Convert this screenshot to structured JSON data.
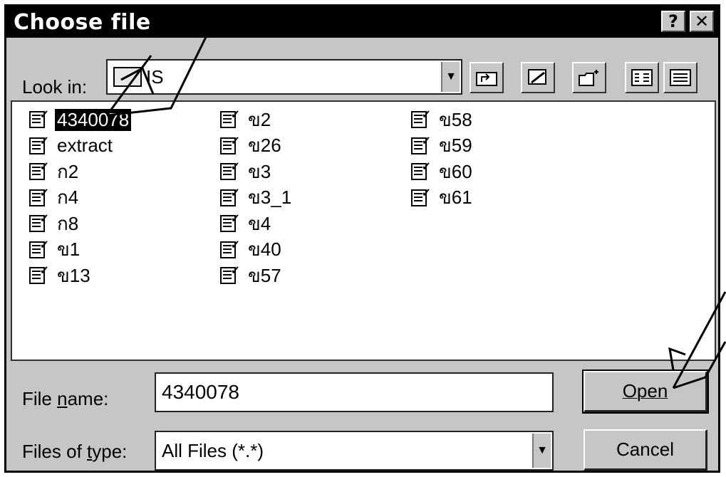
{
  "dialog": {
    "title": "Choose file",
    "help_label": "?",
    "close_label": "✕"
  },
  "lookin": {
    "label": "Look in:",
    "value": "IS"
  },
  "files": [
    {
      "name": "4340078",
      "selected": true
    },
    {
      "name": "extract"
    },
    {
      "name": "ก2"
    },
    {
      "name": "ก4"
    },
    {
      "name": "ก8"
    },
    {
      "name": "ข1"
    },
    {
      "name": "ข13"
    },
    {
      "name": "ข2"
    },
    {
      "name": "ข26"
    },
    {
      "name": "ข3"
    },
    {
      "name": "ข3_1"
    },
    {
      "name": "ข4"
    },
    {
      "name": "ข40"
    },
    {
      "name": "ข57"
    },
    {
      "name": "ข58"
    },
    {
      "name": "ข59"
    },
    {
      "name": "ข60"
    },
    {
      "name": "ข61"
    }
  ],
  "filename": {
    "label": "File name:",
    "value": "4340078"
  },
  "filetype": {
    "label": "Files of type:",
    "value": "All Files (*.*)"
  },
  "buttons": {
    "open": "Open",
    "cancel": "Cancel"
  }
}
